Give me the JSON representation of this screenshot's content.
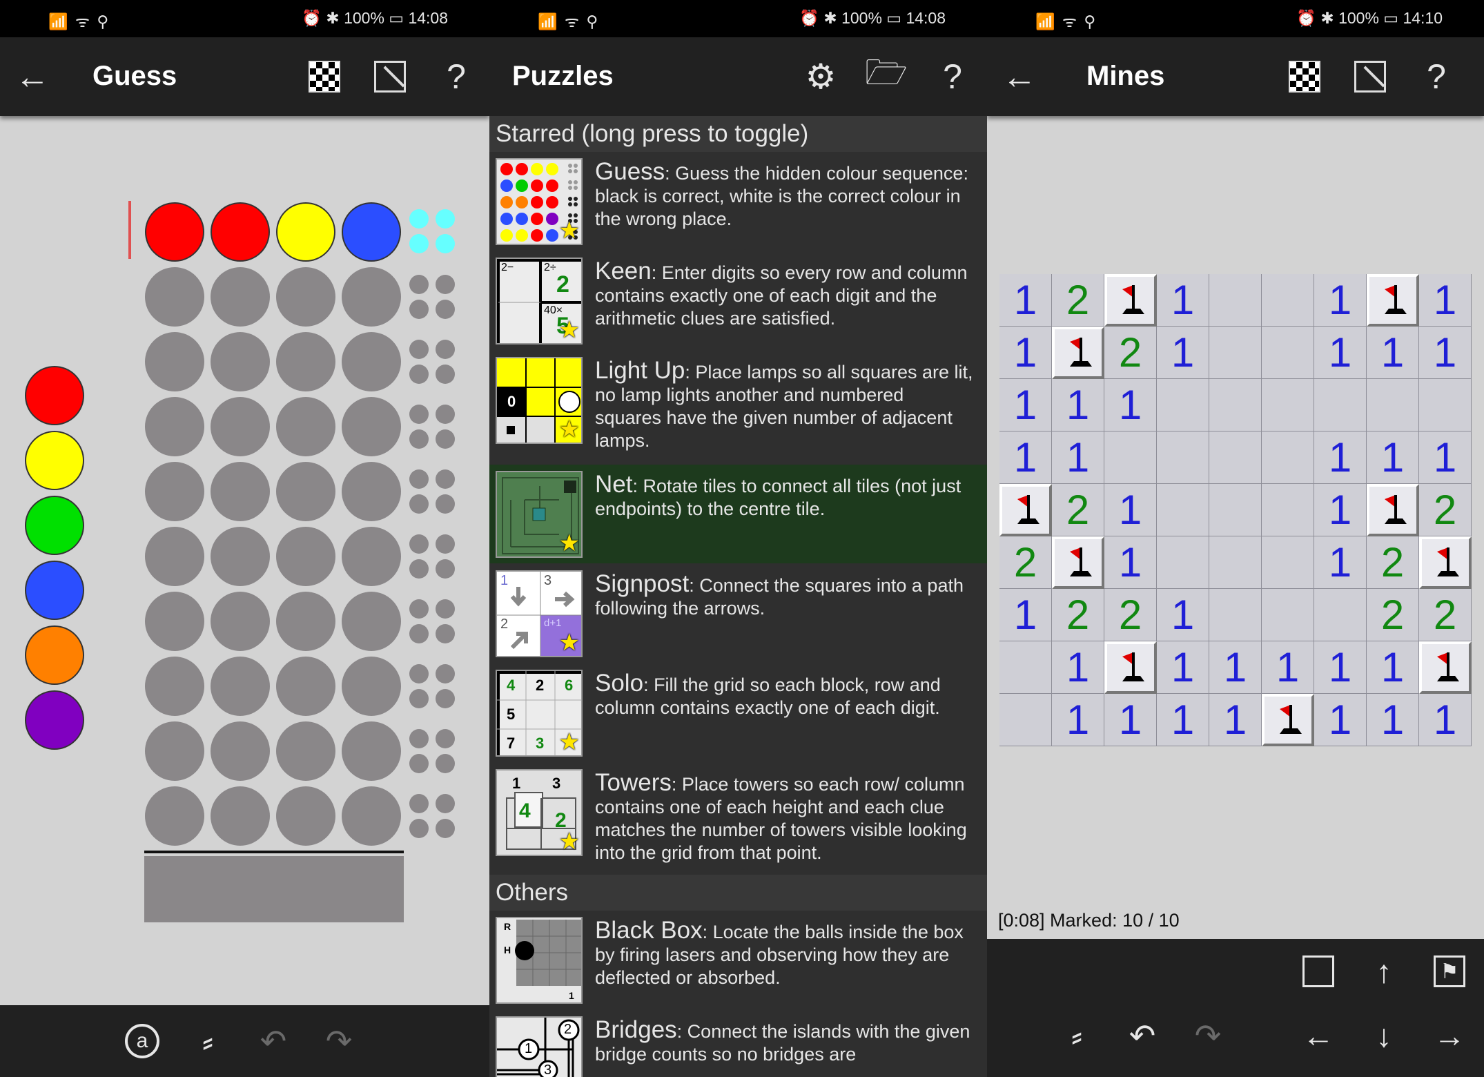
{
  "status_bars": [
    {
      "signal": "📶 ᯤ ⚲",
      "icons": "⏰ ✱",
      "battery": "100%",
      "time": "14:08"
    },
    {
      "signal": "📶 ᯤ ⚲",
      "icons": "⏰ ✱",
      "battery": "100%",
      "time": "14:08"
    },
    {
      "signal": "📶 ᯤ ⚲",
      "icons": "⏰ ✱",
      "battery": "100%",
      "time": "14:10"
    }
  ],
  "guess": {
    "title": "Guess",
    "current_row": [
      "#ff0000",
      "#ff0000",
      "#ffff00",
      "#2b4eff"
    ],
    "feedback_color": "#66ffff",
    "palette": [
      "#ff0000",
      "#ffff00",
      "#00e000",
      "#2b4eff",
      "#ff8000",
      "#8000c0"
    ],
    "empty_color": "#8a8789",
    "empty_rows": 9
  },
  "puzzles": {
    "title": "Puzzles",
    "sections": [
      {
        "label": "Starred (long press to toggle)"
      },
      {
        "label": "Others"
      }
    ],
    "items": [
      {
        "name": "Guess",
        "desc": ": Guess the hidden colour sequence: black is correct, white is the correct colour in the wrong place."
      },
      {
        "name": "Keen",
        "desc": ": Enter digits so every row and column contains exactly one of each digit and the arithmetic clues are satisfied."
      },
      {
        "name": "Light Up",
        "desc": ": Place lamps so all squares are lit, no lamp lights another and numbered squares have the given number of adjacent lamps."
      },
      {
        "name": "Net",
        "desc": ": Rotate tiles to connect all tiles (not just endpoints) to the centre tile."
      },
      {
        "name": "Signpost",
        "desc": ": Connect the squares into a path following the arrows."
      },
      {
        "name": "Solo",
        "desc": ": Fill the grid so each block, row and column contains exactly one of each digit."
      },
      {
        "name": "Towers",
        "desc": ": Place towers so each row/ column contains one of each height and each clue matches the number of towers visible looking into the grid from that point."
      },
      {
        "name": "Black Box",
        "desc": ": Locate the balls inside the box by firing lasers and observing how they are deflected or absorbed."
      },
      {
        "name": "Bridges",
        "desc": ": Connect the islands with the given bridge counts so no bridges are"
      }
    ],
    "thumb_text": {
      "keen": [
        "2−",
        "2÷",
        "2",
        "40×",
        "5"
      ],
      "lightup": [
        "0"
      ],
      "signpost": [
        "1",
        "3",
        "2",
        "d+1"
      ],
      "solo": [
        "4",
        "2",
        "6",
        "5",
        "7",
        "3"
      ],
      "towers": [
        "1",
        "3",
        "4",
        "2"
      ],
      "blackbox": [
        "R",
        "H",
        "1"
      ],
      "bridges": [
        "2",
        "1",
        "3"
      ]
    }
  },
  "mines": {
    "title": "Mines",
    "status": "[0:08] Marked: 10 / 10",
    "grid": [
      [
        "1",
        "2",
        "F",
        "1",
        "",
        "",
        "1",
        "F",
        "1"
      ],
      [
        "1",
        "F",
        "2",
        "1",
        "",
        "",
        "1",
        "1",
        "1"
      ],
      [
        "1",
        "1",
        "1",
        "",
        "",
        "",
        "",
        "",
        ""
      ],
      [
        "1",
        "1",
        "",
        "",
        "",
        "",
        "1",
        "1",
        "1"
      ],
      [
        "F",
        "2",
        "1",
        "",
        "",
        "",
        "1",
        "F",
        "2"
      ],
      [
        "2",
        "F",
        "1",
        "",
        "",
        "",
        "1",
        "2",
        "F"
      ],
      [
        "1",
        "2",
        "2",
        "1",
        "",
        "",
        "",
        "2",
        "2"
      ],
      [
        "",
        "1",
        "F",
        "1",
        "1",
        "1",
        "1",
        "1",
        "F"
      ],
      [
        "",
        "1",
        "1",
        "1",
        "1",
        "F",
        "1",
        "1",
        "1"
      ]
    ]
  }
}
